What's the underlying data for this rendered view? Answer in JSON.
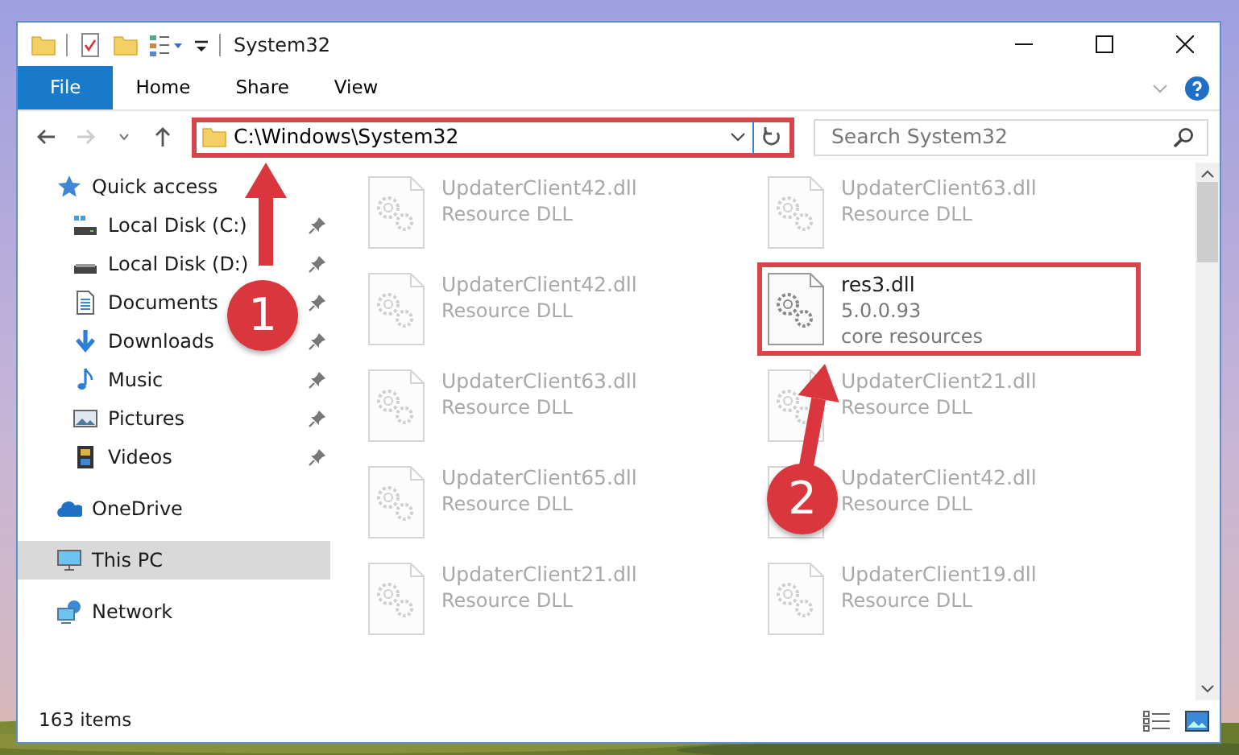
{
  "window": {
    "title": "System32"
  },
  "ribbon": {
    "tabs": [
      {
        "label": "File",
        "selected": true
      },
      {
        "label": "Home",
        "selected": false
      },
      {
        "label": "Share",
        "selected": false
      },
      {
        "label": "View",
        "selected": false
      }
    ]
  },
  "address_bar": {
    "path": "C:\\Windows\\System32",
    "highlighted": true
  },
  "search": {
    "placeholder": "Search System32"
  },
  "sidebar": {
    "items": [
      {
        "label": "Quick access",
        "selected": false,
        "children": [
          {
            "label": "Local Disk (C:)",
            "pinned": true,
            "selected": false
          },
          {
            "label": "Local Disk (D:)",
            "pinned": true,
            "selected": false
          },
          {
            "label": "Documents",
            "pinned": true,
            "selected": false
          },
          {
            "label": "Downloads",
            "pinned": true,
            "selected": false
          },
          {
            "label": "Music",
            "pinned": true,
            "selected": false
          },
          {
            "label": "Pictures",
            "pinned": true,
            "selected": false
          },
          {
            "label": "Videos",
            "pinned": true,
            "selected": false
          }
        ]
      },
      {
        "label": "OneDrive",
        "selected": false
      },
      {
        "label": "This PC",
        "selected": true
      },
      {
        "label": "Network",
        "selected": false
      }
    ]
  },
  "files": [
    {
      "name": "UpdaterClient42.dll",
      "lines": [
        "Resource DLL"
      ],
      "faded": true,
      "highlighted": false
    },
    {
      "name": "UpdaterClient63.dll",
      "lines": [
        "Resource DLL"
      ],
      "faded": true,
      "highlighted": false
    },
    {
      "name": "UpdaterClient42.dll",
      "lines": [
        "Resource DLL"
      ],
      "faded": true,
      "highlighted": false
    },
    {
      "name": "res3.dll",
      "lines": [
        "5.0.0.93",
        "core resources"
      ],
      "faded": false,
      "highlighted": true
    },
    {
      "name": "UpdaterClient63.dll",
      "lines": [
        "Resource DLL"
      ],
      "faded": true,
      "highlighted": false
    },
    {
      "name": "UpdaterClient21.dll",
      "lines": [
        "Resource DLL"
      ],
      "faded": true,
      "highlighted": false
    },
    {
      "name": "UpdaterClient65.dll",
      "lines": [
        "Resource DLL"
      ],
      "faded": true,
      "highlighted": false
    },
    {
      "name": "UpdaterClient42.dll",
      "lines": [
        "Resource DLL"
      ],
      "faded": true,
      "highlighted": false
    },
    {
      "name": "UpdaterClient21.dll",
      "lines": [
        "Resource DLL"
      ],
      "faded": true,
      "highlighted": false
    },
    {
      "name": "UpdaterClient19.dll",
      "lines": [
        "Resource DLL"
      ],
      "faded": true,
      "highlighted": false
    }
  ],
  "status_bar": {
    "count": "163 items"
  },
  "annotations": [
    {
      "number": "1"
    },
    {
      "number": "2"
    }
  ]
}
